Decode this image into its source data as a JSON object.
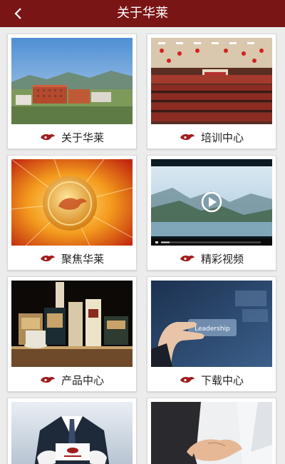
{
  "header": {
    "title": "关于华莱",
    "back_icon": "chevron-left-icon",
    "bg_color": "#7a1515"
  },
  "cards": [
    {
      "label": "关于华莱"
    },
    {
      "label": "培训中心"
    },
    {
      "label": "聚焦华莱"
    },
    {
      "label": "精彩视频"
    },
    {
      "label": "产品中心"
    },
    {
      "label": "下载中心"
    },
    {
      "label": ""
    },
    {
      "label": ""
    }
  ],
  "thumb_texts": {
    "leadership": "Leadership"
  },
  "logo_icon": "hualai-logo-icon",
  "accent_color": "#a01c1c"
}
